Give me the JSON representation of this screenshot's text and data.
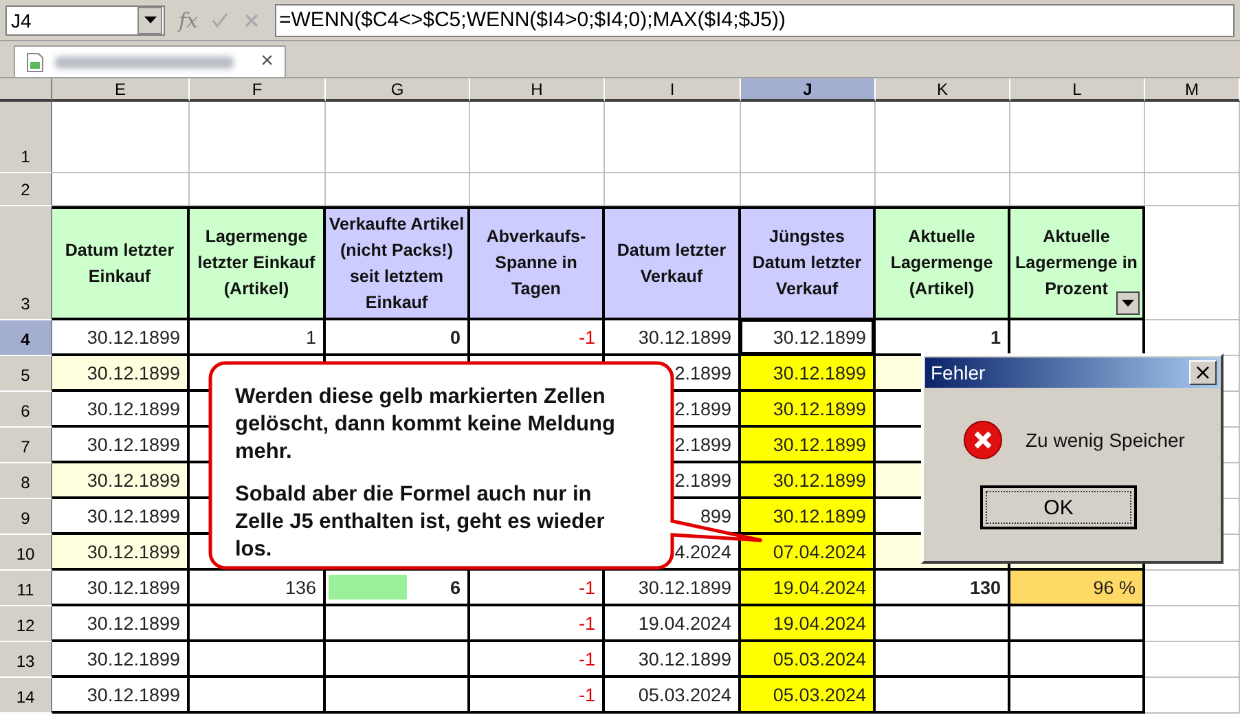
{
  "formula_bar": {
    "cell_ref": "J4",
    "fx": "fx",
    "formula": "=WENN($C4<>$C5;WENN($I4>0;$I4;0);MAX($I4;$J5))"
  },
  "tab": {
    "close": "×"
  },
  "columns": [
    {
      "label": "E",
      "selected": false
    },
    {
      "label": "F",
      "selected": false
    },
    {
      "label": "G",
      "selected": false
    },
    {
      "label": "H",
      "selected": false
    },
    {
      "label": "I",
      "selected": false
    },
    {
      "label": "J",
      "selected": true
    },
    {
      "label": "K",
      "selected": false
    },
    {
      "label": "L",
      "selected": false
    },
    {
      "label": "M",
      "selected": false
    }
  ],
  "header_row": {
    "label": "3",
    "selected": false,
    "cells": [
      {
        "text": "Datum letzter Einkauf",
        "color": "#ccffcc"
      },
      {
        "text": "Lagermenge letzter Einkauf (Artikel)",
        "color": "#ccffcc"
      },
      {
        "text": "Verkaufte Artikel (nicht Packs!) seit letztem Einkauf",
        "color": "#ccccff"
      },
      {
        "text": "Abverkaufs-Spanne in Tagen",
        "color": "#ccccff"
      },
      {
        "text": "Datum letzter Verkauf",
        "color": "#ccccff"
      },
      {
        "text": "Jüngstes Datum letzter Verkauf",
        "color": "#ccccff"
      },
      {
        "text": "Aktuelle Lagermenge (Artikel)",
        "color": "#ccffcc"
      },
      {
        "text": "Aktuelle Lagermenge in Prozent",
        "color": "#ccffcc",
        "filter": true
      }
    ]
  },
  "empty_rows": [
    {
      "label": "1",
      "selected": false
    },
    {
      "label": "2",
      "selected": false
    }
  ],
  "rows": [
    {
      "label": "4",
      "selected": true,
      "highlight": false,
      "cells": [
        {
          "kind": "plain",
          "text": "30.12.1899"
        },
        {
          "kind": "plain",
          "text": "1"
        },
        {
          "kind": "bold",
          "text": "0"
        },
        {
          "kind": "negative",
          "text": "-1"
        },
        {
          "kind": "plain",
          "text": "30.12.1899"
        },
        {
          "kind": "active",
          "text": "30.12.1899"
        },
        {
          "kind": "bold",
          "text": "1"
        },
        {
          "kind": "empty"
        },
        {
          "kind": "empty"
        }
      ]
    },
    {
      "label": "5",
      "selected": false,
      "highlight": true,
      "cells": [
        {
          "kind": "plain",
          "text": "30.12.1899"
        },
        {
          "kind": "empty"
        },
        {
          "kind": "empty"
        },
        {
          "kind": "empty"
        },
        {
          "kind": "plain",
          "text": "2.1899"
        },
        {
          "kind": "yellow",
          "text": "30.12.1899"
        },
        {
          "kind": "empty"
        },
        {
          "kind": "empty"
        },
        {
          "kind": "empty"
        }
      ]
    },
    {
      "label": "6",
      "selected": false,
      "highlight": false,
      "cells": [
        {
          "kind": "plain",
          "text": "30.12.1899"
        },
        {
          "kind": "empty"
        },
        {
          "kind": "empty"
        },
        {
          "kind": "empty"
        },
        {
          "kind": "plain",
          "text": "2.1899"
        },
        {
          "kind": "yellow",
          "text": "30.12.1899"
        },
        {
          "kind": "empty"
        },
        {
          "kind": "empty"
        },
        {
          "kind": "empty"
        }
      ]
    },
    {
      "label": "7",
      "selected": false,
      "highlight": false,
      "cells": [
        {
          "kind": "plain",
          "text": "30.12.1899"
        },
        {
          "kind": "empty"
        },
        {
          "kind": "empty"
        },
        {
          "kind": "empty"
        },
        {
          "kind": "plain",
          "text": "2.1899"
        },
        {
          "kind": "yellow",
          "text": "30.12.1899"
        },
        {
          "kind": "empty"
        },
        {
          "kind": "empty"
        },
        {
          "kind": "empty"
        }
      ]
    },
    {
      "label": "8",
      "selected": false,
      "highlight": true,
      "cells": [
        {
          "kind": "plain",
          "text": "30.12.1899"
        },
        {
          "kind": "empty"
        },
        {
          "kind": "empty"
        },
        {
          "kind": "empty"
        },
        {
          "kind": "plain",
          "text": "2.1899"
        },
        {
          "kind": "yellow",
          "text": "30.12.1899"
        },
        {
          "kind": "empty"
        },
        {
          "kind": "empty"
        },
        {
          "kind": "empty"
        }
      ]
    },
    {
      "label": "9",
      "selected": false,
      "highlight": false,
      "cells": [
        {
          "kind": "plain",
          "text": "30.12.1899"
        },
        {
          "kind": "empty"
        },
        {
          "kind": "empty"
        },
        {
          "kind": "empty"
        },
        {
          "kind": "plain",
          "text": "899"
        },
        {
          "kind": "yellow",
          "text": "30.12.1899"
        },
        {
          "kind": "empty"
        },
        {
          "kind": "empty"
        },
        {
          "kind": "empty"
        }
      ]
    },
    {
      "label": "10",
      "selected": false,
      "highlight": true,
      "cells": [
        {
          "kind": "plain",
          "text": "30.12.1899"
        },
        {
          "kind": "empty"
        },
        {
          "kind": "empty"
        },
        {
          "kind": "empty"
        },
        {
          "kind": "plain",
          "text": "4.2024"
        },
        {
          "kind": "yellow",
          "text": "07.04.2024"
        },
        {
          "kind": "empty"
        },
        {
          "kind": "empty"
        },
        {
          "kind": "empty"
        }
      ]
    },
    {
      "label": "11",
      "selected": false,
      "highlight": false,
      "cells": [
        {
          "kind": "plain",
          "text": "30.12.1899"
        },
        {
          "kind": "plain",
          "text": "136"
        },
        {
          "kind": "bar",
          "text": "6",
          "level": 0.55
        },
        {
          "kind": "negative",
          "text": "-1"
        },
        {
          "kind": "plain",
          "text": "30.12.1899"
        },
        {
          "kind": "yellow",
          "text": "19.04.2024"
        },
        {
          "kind": "bold",
          "text": "130"
        },
        {
          "kind": "percent",
          "text": "96 %"
        },
        {
          "kind": "empty"
        }
      ]
    },
    {
      "label": "12",
      "selected": false,
      "highlight": false,
      "cells": [
        {
          "kind": "plain",
          "text": "30.12.1899"
        },
        {
          "kind": "empty"
        },
        {
          "kind": "empty"
        },
        {
          "kind": "negative",
          "text": "-1"
        },
        {
          "kind": "plain",
          "text": "19.04.2024"
        },
        {
          "kind": "yellow",
          "text": "19.04.2024"
        },
        {
          "kind": "empty"
        },
        {
          "kind": "empty"
        },
        {
          "kind": "empty"
        }
      ]
    },
    {
      "label": "13",
      "selected": false,
      "highlight": false,
      "cells": [
        {
          "kind": "plain",
          "text": "30.12.1899"
        },
        {
          "kind": "empty"
        },
        {
          "kind": "empty"
        },
        {
          "kind": "negative",
          "text": "-1"
        },
        {
          "kind": "plain",
          "text": "30.12.1899"
        },
        {
          "kind": "yellow",
          "text": "05.03.2024"
        },
        {
          "kind": "empty"
        },
        {
          "kind": "empty"
        },
        {
          "kind": "empty"
        }
      ]
    },
    {
      "label": "14",
      "selected": false,
      "highlight": false,
      "cells": [
        {
          "kind": "plain",
          "text": "30.12.1899"
        },
        {
          "kind": "empty"
        },
        {
          "kind": "empty"
        },
        {
          "kind": "negative",
          "text": "-1"
        },
        {
          "kind": "plain",
          "text": "05.03.2024"
        },
        {
          "kind": "yellow",
          "text": "05.03.2024"
        },
        {
          "kind": "empty"
        },
        {
          "kind": "empty"
        },
        {
          "kind": "empty"
        }
      ]
    }
  ],
  "callout": {
    "paragraphs": [
      "Werden diese gelb markierten Zellen gelöscht, dann kommt keine Meldung mehr.",
      "Sobald aber die Formel auch nur in Zelle J5 enthalten ist, geht es wieder los."
    ]
  },
  "dialog": {
    "title": "Fehler",
    "close": "×",
    "message": "Zu wenig Speicher",
    "button": "OK"
  }
}
